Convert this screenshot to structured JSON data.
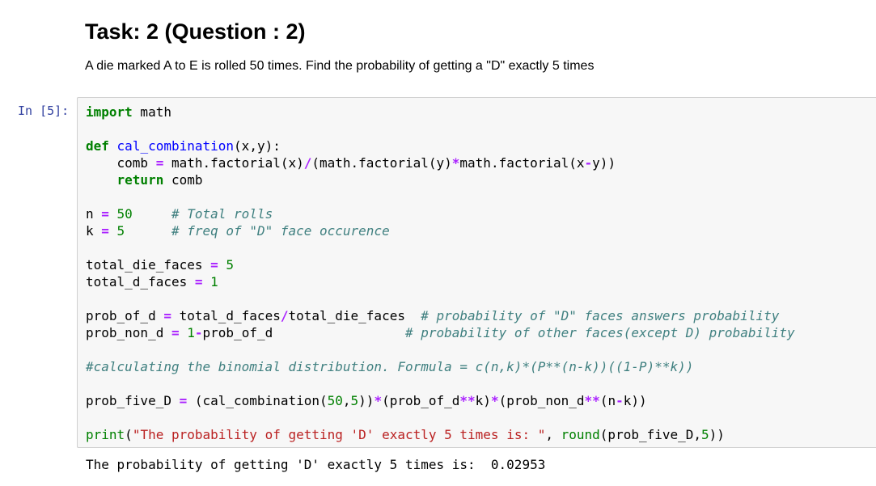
{
  "markdown": {
    "title": "Task: 2 (Question : 2)",
    "text": "A die marked A to E is rolled 50 times. Find the probability of getting a \"D\" exactly 5 times"
  },
  "cell": {
    "prompt": "In [5]:",
    "code_lines": [
      [
        [
          "kw",
          "import"
        ],
        [
          "t",
          " math"
        ]
      ],
      [],
      [
        [
          "kw",
          "def"
        ],
        [
          "t",
          " "
        ],
        [
          "def",
          "cal_combination"
        ],
        [
          "t",
          "(x,y):"
        ]
      ],
      [
        [
          "t",
          "    comb "
        ],
        [
          "op",
          "="
        ],
        [
          "t",
          " math.factorial(x)"
        ],
        [
          "op",
          "/"
        ],
        [
          "t",
          "(math.factorial(y)"
        ],
        [
          "op",
          "*"
        ],
        [
          "t",
          "math.factorial(x"
        ],
        [
          "op",
          "-"
        ],
        [
          "t",
          "y))"
        ]
      ],
      [
        [
          "t",
          "    "
        ],
        [
          "kw",
          "return"
        ],
        [
          "t",
          " comb"
        ]
      ],
      [],
      [
        [
          "t",
          "n "
        ],
        [
          "op",
          "="
        ],
        [
          "t",
          " "
        ],
        [
          "num",
          "50"
        ],
        [
          "t",
          "     "
        ],
        [
          "cm",
          "# Total rolls"
        ]
      ],
      [
        [
          "t",
          "k "
        ],
        [
          "op",
          "="
        ],
        [
          "t",
          " "
        ],
        [
          "num",
          "5"
        ],
        [
          "t",
          "      "
        ],
        [
          "cm",
          "# freq of \"D\" face occurence"
        ]
      ],
      [],
      [
        [
          "t",
          "total_die_faces "
        ],
        [
          "op",
          "="
        ],
        [
          "t",
          " "
        ],
        [
          "num",
          "5"
        ]
      ],
      [
        [
          "t",
          "total_d_faces "
        ],
        [
          "op",
          "="
        ],
        [
          "t",
          " "
        ],
        [
          "num",
          "1"
        ]
      ],
      [],
      [
        [
          "t",
          "prob_of_d "
        ],
        [
          "op",
          "="
        ],
        [
          "t",
          " total_d_faces"
        ],
        [
          "op",
          "/"
        ],
        [
          "t",
          "total_die_faces  "
        ],
        [
          "cm",
          "# probability of \"D\" faces answers probability"
        ]
      ],
      [
        [
          "t",
          "prob_non_d "
        ],
        [
          "op",
          "="
        ],
        [
          "t",
          " "
        ],
        [
          "num",
          "1"
        ],
        [
          "op",
          "-"
        ],
        [
          "t",
          "prob_of_d                 "
        ],
        [
          "cm",
          "# probability of other faces(except D) probability"
        ]
      ],
      [],
      [
        [
          "cm",
          "#calculating the binomial distribution. Formula = c(n,k)*(P**(n-k))((1-P)**k))"
        ]
      ],
      [],
      [
        [
          "t",
          "prob_five_D "
        ],
        [
          "op",
          "="
        ],
        [
          "t",
          " (cal_combination("
        ],
        [
          "num",
          "50"
        ],
        [
          "t",
          ","
        ],
        [
          "num",
          "5"
        ],
        [
          "t",
          "))"
        ],
        [
          "op",
          "*"
        ],
        [
          "t",
          "(prob_of_d"
        ],
        [
          "op",
          "**"
        ],
        [
          "t",
          "k)"
        ],
        [
          "op",
          "*"
        ],
        [
          "t",
          "(prob_non_d"
        ],
        [
          "op",
          "**"
        ],
        [
          "t",
          "(n"
        ],
        [
          "op",
          "-"
        ],
        [
          "t",
          "k))"
        ]
      ],
      [],
      [
        [
          "bi",
          "print"
        ],
        [
          "t",
          "("
        ],
        [
          "str",
          "\"The probability of getting 'D' exactly 5 times is: \""
        ],
        [
          "t",
          ", "
        ],
        [
          "bi",
          "round"
        ],
        [
          "t",
          "(prob_five_D,"
        ],
        [
          "num",
          "5"
        ],
        [
          "t",
          "))"
        ]
      ]
    ],
    "output": "The probability of getting 'D' exactly 5 times is:  0.02953"
  }
}
